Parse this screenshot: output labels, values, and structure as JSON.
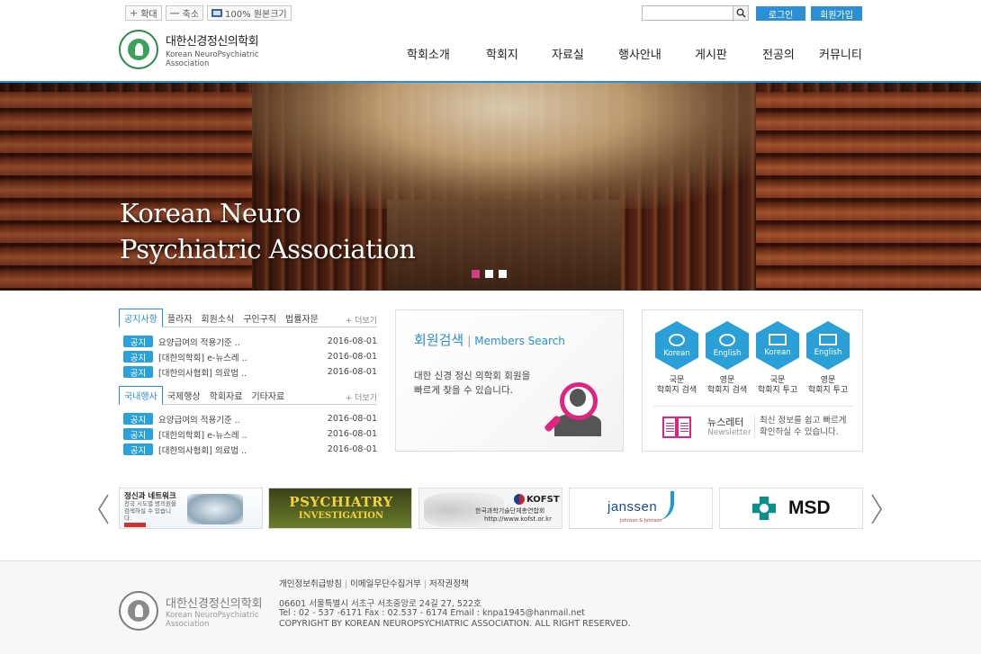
{
  "utility": {
    "zoom_in": "확대",
    "zoom_out": "축소",
    "original": "100% 원본크기"
  },
  "search": {
    "placeholder": ""
  },
  "auth": {
    "login": "로그인",
    "join": "회원가입"
  },
  "logo": {
    "ko": "대한신경정신의학회",
    "en_line1": "Korean NeuroPsychiatric",
    "en_line2": "Association"
  },
  "nav": [
    "학회소개",
    "학회지",
    "자료실",
    "행사안내",
    "게시판",
    "전공의",
    "커뮤니티"
  ],
  "hero": {
    "line1": "Korean Neuro",
    "line2": "Psychiatric Association",
    "slides": 3,
    "active_slide": 1
  },
  "notice1": {
    "tabs": [
      "공지사항",
      "플라자",
      "회원소식",
      "구인구직",
      "법률자문"
    ],
    "more": "+ 더보기",
    "rows": [
      {
        "badge": "공지",
        "text": "요양급여의 적용기준 ..",
        "date": "2016-08-01"
      },
      {
        "badge": "공지",
        "text": "[대한의학회] e-뉴스레 ..",
        "date": "2016-08-01"
      },
      {
        "badge": "공지",
        "text": "[대한의사협회] 의료법 ..",
        "date": "2016-08-01"
      }
    ]
  },
  "notice2": {
    "tabs": [
      "국내행사",
      "국제행상",
      "학회자료",
      "기타자료"
    ],
    "more": "+ 더보기",
    "rows": [
      {
        "badge": "공지",
        "text": "요양급여의 적용기준 ..",
        "date": "2016-08-01"
      },
      {
        "badge": "공지",
        "text": "[대한의학회] e-뉴스레 ..",
        "date": "2016-08-01"
      },
      {
        "badge": "공지",
        "text": "[대한의사협회] 의료법 ..",
        "date": "2016-08-01"
      }
    ]
  },
  "member_search": {
    "title": "회원검색",
    "title_en": "Members Search",
    "desc_line1": "대한 신경 정신 의학회 회원을",
    "desc_line2": "빠르게 찾을 수 있습니다."
  },
  "journals": [
    {
      "label": "Korean",
      "cap1": "국문",
      "cap2": "학회지 검색",
      "icon": "globe-icon"
    },
    {
      "label": "English",
      "cap1": "영문",
      "cap2": "학회지 검색",
      "icon": "globe-icon"
    },
    {
      "label": "Korean",
      "cap1": "국문",
      "cap2": "학회지 투고",
      "icon": "monitor-icon"
    },
    {
      "label": "English",
      "cap1": "영문",
      "cap2": "학회지 투고",
      "icon": "monitor-icon"
    }
  ],
  "newsletter": {
    "title": "뉴스레터",
    "en": "Newsletter",
    "desc_line1": "최신 정보를 쉽고 빠르게",
    "desc_line2": "확인하실 수 있습니다."
  },
  "banners": {
    "b1": {
      "title": "정신과 네트워크",
      "sub": "전국 시도별 병의원을 검색하실 수 있습니다."
    },
    "b2": {
      "title": "PSYCHIATRY",
      "sub": "INVESTIGATION"
    },
    "b3": {
      "brand": "KOFST",
      "line1": "한국과학기술단체총연합회",
      "line2": "http://www.kofst.or.kr"
    },
    "b4": {
      "brand": "janssen",
      "sub": "Johnson & Johnson"
    },
    "b5": {
      "brand": "MSD"
    }
  },
  "footer": {
    "links": [
      "개인정보취급방침",
      "이메일무단수집거부",
      "저작권정책"
    ],
    "logo_ko": "대한신경정신의학회",
    "logo_en1": "Korean NeuroPsychiatric",
    "logo_en2": "Association",
    "address": "06601 서울특별시 서초구 서초중앙로 24길 27, 522호",
    "contact": "Tel : 02 - 537 -6171 Fax : 02.537 - 6174 Email : knpa1945@hanmail.net",
    "copyright": "COPYRIGHT BY KOREAN NEUROPSYCHIATRIC ASSOCIATION. ALL RIGHT RESERVED."
  },
  "colors": {
    "accent": "#2a8fd6",
    "badge": "#2aa1dc",
    "pink": "#e0247f"
  }
}
